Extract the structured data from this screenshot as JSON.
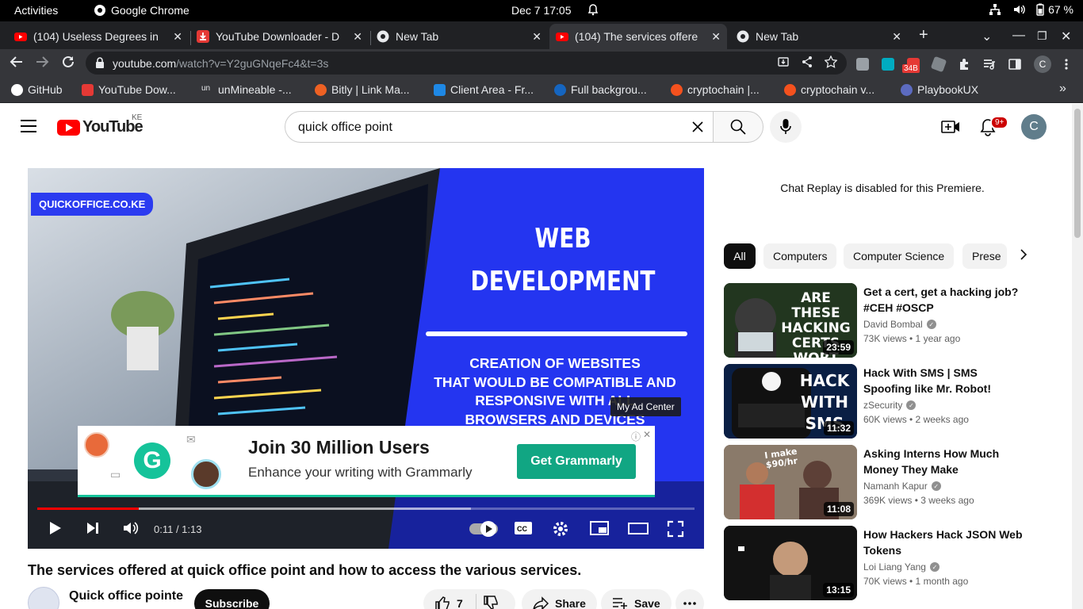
{
  "system": {
    "activities": "Activities",
    "app_name": "Google Chrome",
    "clock": "Dec 7  17:05",
    "battery": "67 %"
  },
  "tabs": [
    {
      "title": "(104) Useless Degrees in",
      "favicon": "youtube-icon"
    },
    {
      "title": "YouTube Downloader - D",
      "favicon": "download-icon"
    },
    {
      "title": "New Tab",
      "favicon": "chrome-icon"
    },
    {
      "title": "(104) The services offere",
      "favicon": "youtube-icon",
      "active": true
    },
    {
      "title": "New Tab",
      "favicon": "chrome-icon"
    }
  ],
  "omnibox": {
    "host": "youtube.com",
    "path": "/watch?v=Y2guGNqeFc4&t=3s"
  },
  "extensions": {
    "badge": "34B",
    "profile_initial": "C"
  },
  "bookmarks": [
    {
      "label": "GitHub",
      "color": "#ffffff"
    },
    {
      "label": "YouTube Dow...",
      "color": "#e53935"
    },
    {
      "label": "unMineable -...",
      "color": "#35363a"
    },
    {
      "label": "Bitly | Link Ma...",
      "color": "#ee6123"
    },
    {
      "label": "Client Area - Fr...",
      "color": "#1e88e5"
    },
    {
      "label": "Full backgrou...",
      "color": "#1565c0"
    },
    {
      "label": "cryptochain |...",
      "color": "#f4511e"
    },
    {
      "label": "cryptochain v...",
      "color": "#f4511e"
    },
    {
      "label": "PlaybookUX",
      "color": "#5c6bc0"
    }
  ],
  "yt_header": {
    "logo_text": "YouTube",
    "country": "KE",
    "search_query": "quick office point",
    "notification_count": "9+",
    "avatar_initial": "C"
  },
  "video": {
    "brand": "QUICKOFFICE.CO.KE",
    "heading_line1": "WEB",
    "heading_line2": "DEVELOPMENT",
    "sub_line1": "CREATION OF WEBSITES",
    "sub_line2": "THAT WOULD BE COMPATIBLE AND",
    "sub_line3": "RESPONSIVE WITH ALL",
    "sub_line4": "BROWSERS AND DEVICES",
    "ad_center": "My Ad Center",
    "time": "0:11 / 1:13",
    "played_fraction": 0.155,
    "buffered_fraction": 0.66
  },
  "ad": {
    "headline": "Join 30 Million Users",
    "subline": "Enhance your writing with Grammarly",
    "cta": "Get Grammarly",
    "logo_letter": "G"
  },
  "watch": {
    "title": "The services offered at quick office point and how to access the various services.",
    "channel": "Quick office pointe",
    "subscribe": "Subscribe",
    "likes": "7",
    "share": "Share",
    "save": "Save"
  },
  "sidebar": {
    "chat_replay": "Chat Replay is disabled for this Premiere.",
    "chips": [
      "All",
      "Computers",
      "Computer Science",
      "Prese"
    ],
    "recommendations": [
      {
        "title": "Get a cert, get a hacking job? #CEH #OSCP",
        "channel": "David Bombal",
        "meta": "73K views  • 1 year ago",
        "duration": "23:59",
        "thumb_text": "ARE THESE HACKING CERTS WORT"
      },
      {
        "title": "Hack With SMS | SMS Spoofing like Mr. Robot!",
        "channel": "zSecurity",
        "meta": "60K views  • 2 weeks ago",
        "duration": "11:32",
        "thumb_text": "HACK WITH SMS"
      },
      {
        "title": "Asking Interns How Much Money They Make",
        "channel": "Namanh Kapur",
        "meta": "369K views  • 3 weeks ago",
        "duration": "11:08",
        "thumb_text": "I make $90/hr"
      },
      {
        "title": "How Hackers Hack JSON Web Tokens",
        "channel": "Loi Liang Yang",
        "meta": "70K views  • 1 month ago",
        "duration": "13:15",
        "thumb_text": ""
      }
    ]
  }
}
